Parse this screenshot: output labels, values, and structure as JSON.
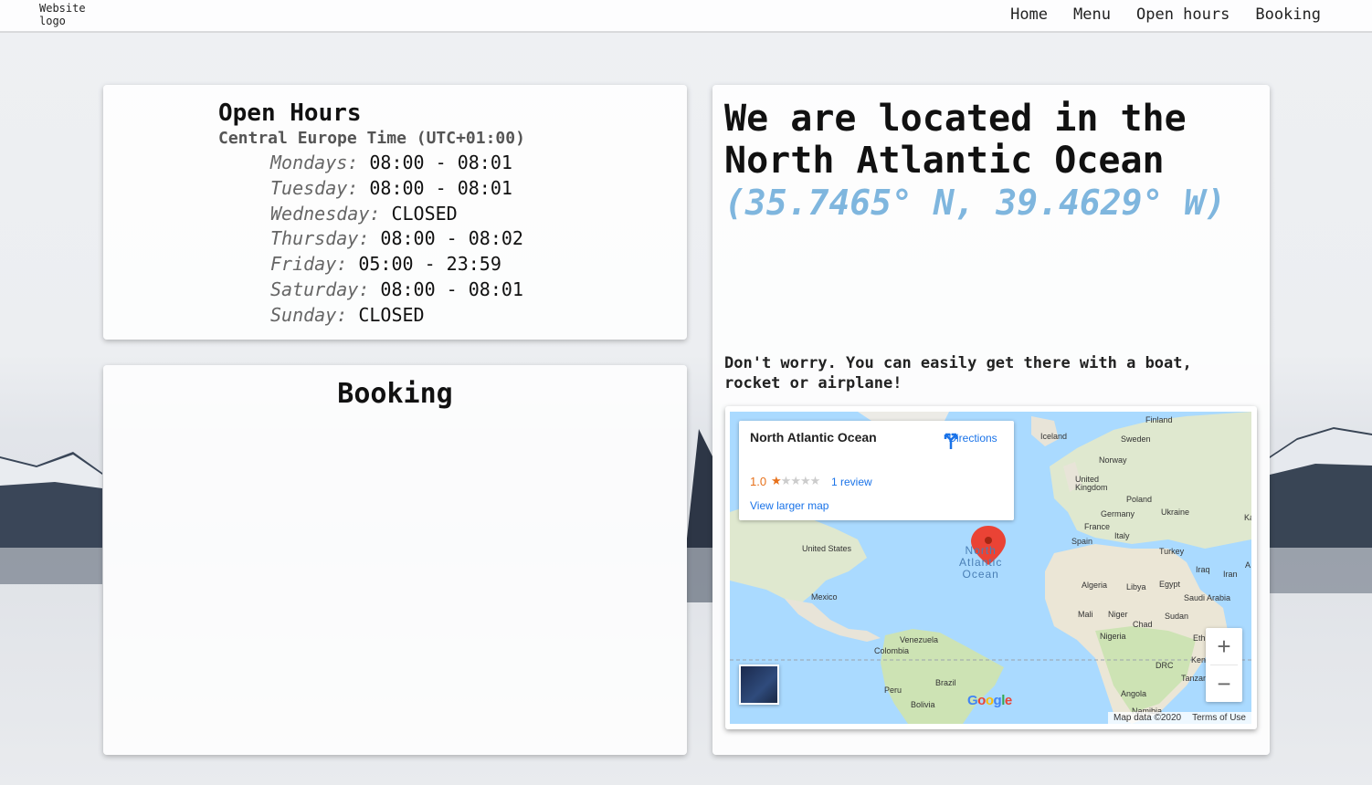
{
  "header": {
    "logo": "Website logo",
    "nav": [
      "Home",
      "Menu",
      "Open hours",
      "Booking"
    ]
  },
  "hours": {
    "title": "Open Hours",
    "timezone": "Central Europe Time (UTC+01:00)",
    "days": [
      {
        "day": "Mondays:",
        "time": "08:00 - 08:01"
      },
      {
        "day": "Tuesday:",
        "time": "08:00 - 08:01"
      },
      {
        "day": "Wednesday:",
        "time": "CLOSED"
      },
      {
        "day": "Thursday:",
        "time": "08:00 - 08:02"
      },
      {
        "day": "Friday:",
        "time": "05:00 - 23:59"
      },
      {
        "day": "Saturday:",
        "time": "08:00 - 08:01"
      },
      {
        "day": "Sunday:",
        "time": "CLOSED"
      }
    ]
  },
  "booking": {
    "title": "Booking"
  },
  "location": {
    "title": "We are located in the North Atlantic Ocean",
    "coords": "(35.7465° N, 39.4629° W)",
    "note": "Don't worry. You can easily get there with a boat, rocket or airplane!"
  },
  "map": {
    "place_name": "North Atlantic Ocean",
    "directions": "Directions",
    "rating": "1.0",
    "stars_filled": 1,
    "stars_total": 5,
    "reviews": "1 review",
    "larger_map": "View larger map",
    "ocean_label": [
      "North",
      "Atlantic",
      "Ocean"
    ],
    "labels": [
      "Finland",
      "Iceland",
      "Sweden",
      "Norway",
      "United Kingdom",
      "Poland",
      "Germany",
      "Ukraine",
      "France",
      "Spain",
      "Italy",
      "Turkey",
      "Iraq",
      "Iran",
      "United States",
      "Mexico",
      "Algeria",
      "Libya",
      "Egypt",
      "Saudi Arabia",
      "Mali",
      "Niger",
      "Chad",
      "Sudan",
      "Ethiopia",
      "Nigeria",
      "Kenya",
      "DRC",
      "Tanzania",
      "Angola",
      "Namibia",
      "Venezuela",
      "Colombia",
      "Peru",
      "Brazil",
      "Bolivia",
      "Ka",
      "A"
    ],
    "zoom_in": "+",
    "zoom_out": "−",
    "map_data": "Map data ©2020",
    "terms": "Terms of Use",
    "google": "Google",
    "colors": {
      "water": "#aadaff",
      "land": "#e8e4d8",
      "green": "#cde3b4",
      "pin": "#ea4335",
      "link": "#1a73e8",
      "accent": "#7fb6de"
    }
  }
}
